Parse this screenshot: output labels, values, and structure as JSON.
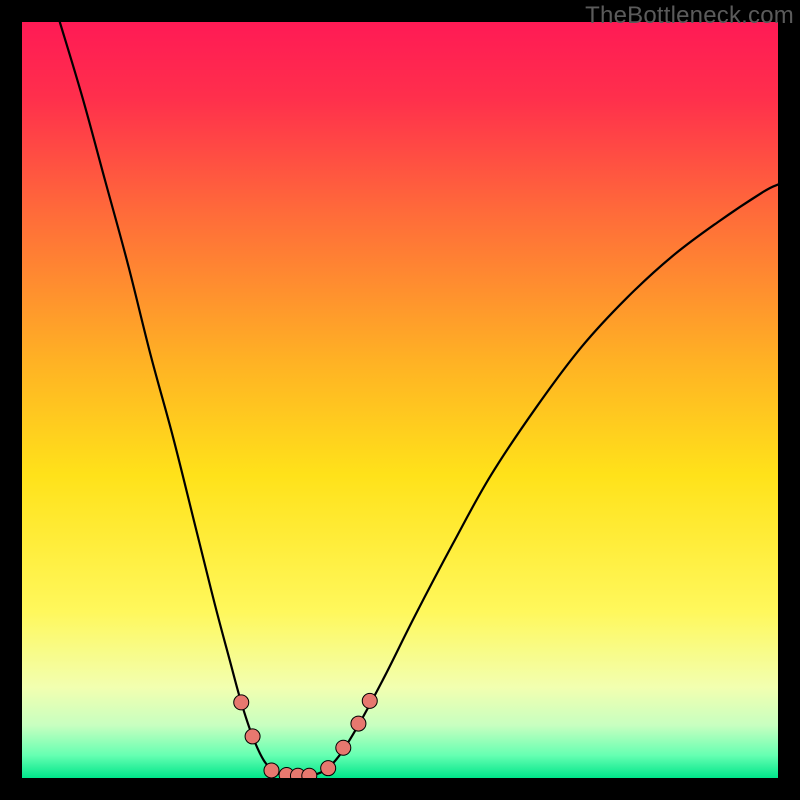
{
  "watermark": "TheBottleneck.com",
  "chart_data": {
    "type": "line",
    "title": "",
    "xlabel": "",
    "ylabel": "",
    "xlim": [
      0,
      100
    ],
    "ylim": [
      0,
      100
    ],
    "background_gradient_stops": [
      {
        "offset": 0.0,
        "color": "#ff1a55"
      },
      {
        "offset": 0.1,
        "color": "#ff2f4c"
      },
      {
        "offset": 0.25,
        "color": "#ff6a3a"
      },
      {
        "offset": 0.45,
        "color": "#ffb224"
      },
      {
        "offset": 0.6,
        "color": "#ffe21a"
      },
      {
        "offset": 0.78,
        "color": "#fff85c"
      },
      {
        "offset": 0.88,
        "color": "#f2ffb0"
      },
      {
        "offset": 0.93,
        "color": "#c8ffc0"
      },
      {
        "offset": 0.97,
        "color": "#66ffb2"
      },
      {
        "offset": 1.0,
        "color": "#00e58a"
      }
    ],
    "series": [
      {
        "name": "left-curve",
        "stroke": "#000000",
        "stroke_width": 2.2,
        "points": [
          {
            "x": 5.0,
            "y": 100.0
          },
          {
            "x": 8.0,
            "y": 90.0
          },
          {
            "x": 11.0,
            "y": 79.0
          },
          {
            "x": 14.0,
            "y": 68.0
          },
          {
            "x": 17.0,
            "y": 56.0
          },
          {
            "x": 20.0,
            "y": 45.0
          },
          {
            "x": 23.0,
            "y": 33.0
          },
          {
            "x": 25.5,
            "y": 23.0
          },
          {
            "x": 27.5,
            "y": 15.5
          },
          {
            "x": 29.0,
            "y": 10.0
          },
          {
            "x": 30.5,
            "y": 5.5
          },
          {
            "x": 32.0,
            "y": 2.3
          },
          {
            "x": 33.5,
            "y": 0.8
          },
          {
            "x": 35.0,
            "y": 0.2
          }
        ]
      },
      {
        "name": "right-curve",
        "stroke": "#000000",
        "stroke_width": 2.2,
        "points": [
          {
            "x": 38.0,
            "y": 0.2
          },
          {
            "x": 40.0,
            "y": 1.0
          },
          {
            "x": 42.0,
            "y": 3.0
          },
          {
            "x": 44.5,
            "y": 7.0
          },
          {
            "x": 48.0,
            "y": 13.5
          },
          {
            "x": 52.0,
            "y": 21.5
          },
          {
            "x": 57.0,
            "y": 31.0
          },
          {
            "x": 62.0,
            "y": 40.0
          },
          {
            "x": 68.0,
            "y": 49.0
          },
          {
            "x": 74.0,
            "y": 57.0
          },
          {
            "x": 80.0,
            "y": 63.5
          },
          {
            "x": 86.0,
            "y": 69.0
          },
          {
            "x": 92.0,
            "y": 73.5
          },
          {
            "x": 98.0,
            "y": 77.5
          },
          {
            "x": 100.0,
            "y": 78.5
          }
        ]
      }
    ],
    "markers": [
      {
        "name": "marker-data",
        "color": "#E7786F",
        "radius": 7.5,
        "stroke": "#000000",
        "points": [
          {
            "x": 29.0,
            "y": 10.0
          },
          {
            "x": 30.5,
            "y": 5.5
          },
          {
            "x": 33.0,
            "y": 1.0
          },
          {
            "x": 35.0,
            "y": 0.4
          },
          {
            "x": 36.5,
            "y": 0.3
          },
          {
            "x": 38.0,
            "y": 0.3
          },
          {
            "x": 40.5,
            "y": 1.3
          },
          {
            "x": 42.5,
            "y": 4.0
          },
          {
            "x": 44.5,
            "y": 7.2
          },
          {
            "x": 46.0,
            "y": 10.2
          }
        ]
      }
    ]
  }
}
